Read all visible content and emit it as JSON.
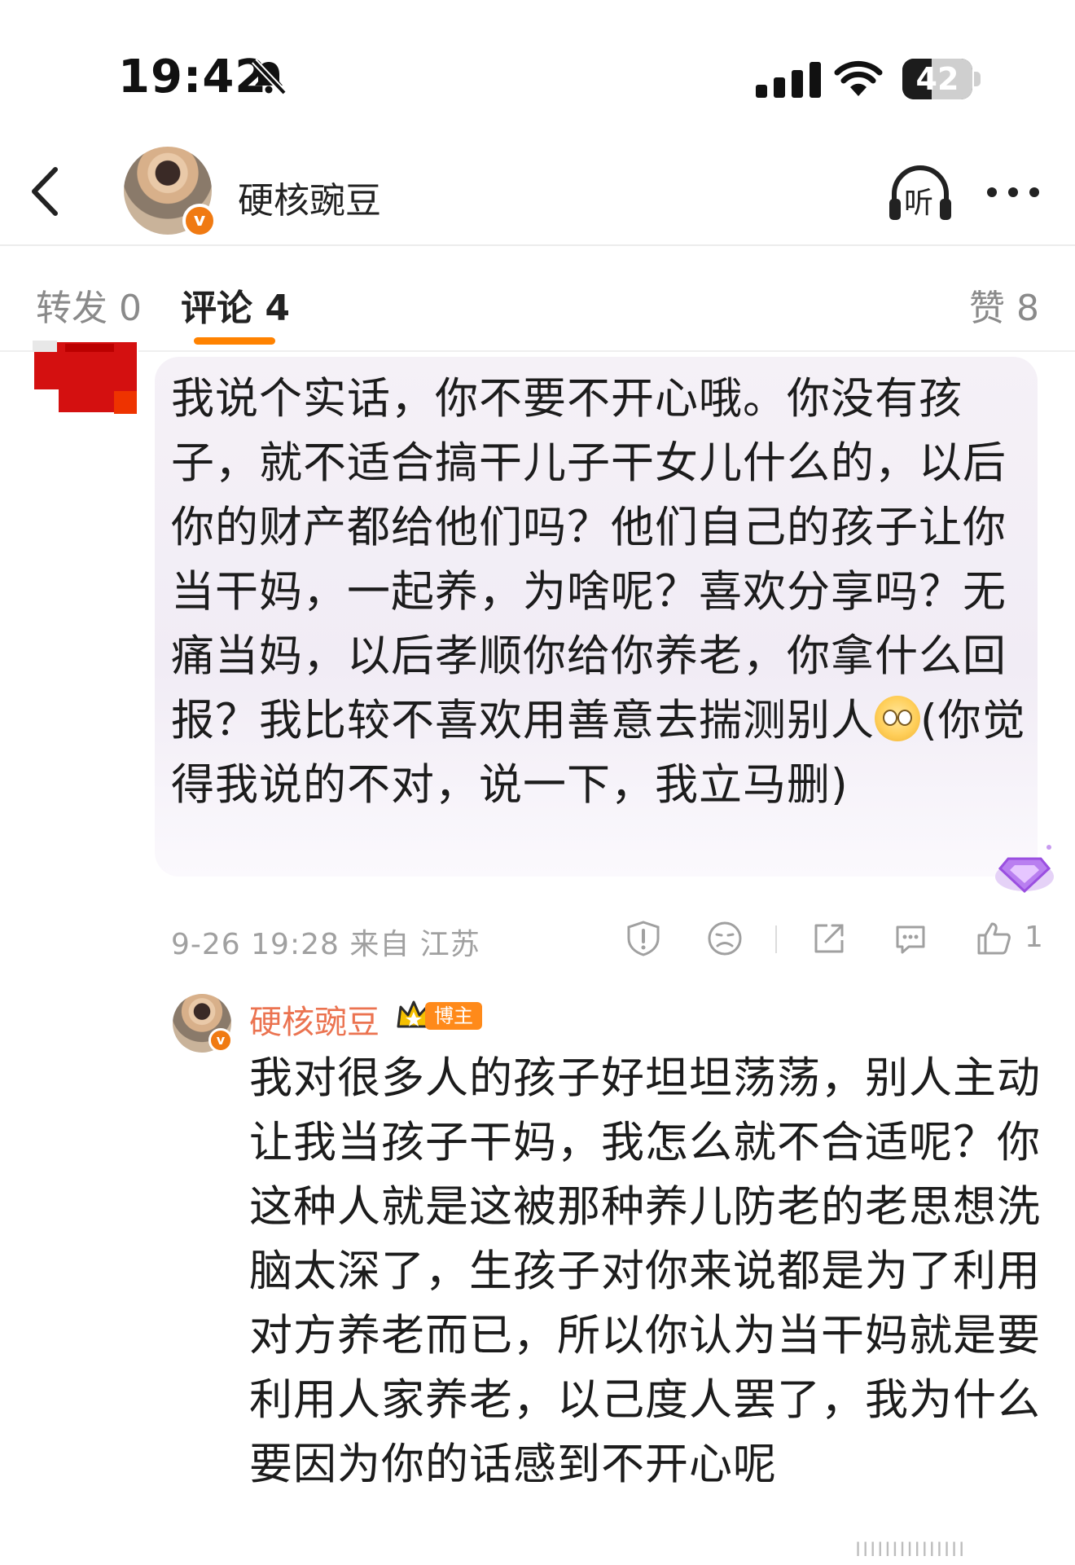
{
  "status_bar": {
    "time": "19:42",
    "battery": "42",
    "battery_level": 0.42
  },
  "header": {
    "username": "硬核豌豆",
    "verified_badge": "v",
    "listen_label": "听"
  },
  "tabs": [
    {
      "label": "转发 0",
      "active": false
    },
    {
      "label": "评论 4",
      "active": true
    },
    {
      "label": "赞 8",
      "active": false
    }
  ],
  "comment": {
    "text": "我说个实话，你不要不开心哦。你没有孩子，就不适合搞干儿子干女儿什么的，以后你的财产都给他们吗？他们自己的孩子让你当干妈，一起养，为啥呢？喜欢分享吗？无痛当妈，以后孝顺你给你养老，你拿什么回报？我比较不喜欢用善意去揣测别人",
    "text_after_emoji": "(你觉得我说的不对，说一下，我立马删)",
    "emoji": "eye-roll-emoji",
    "meta": "9-26 19:28 来自 江苏",
    "like_count": "1"
  },
  "reply": {
    "username": "硬核豌豆",
    "badge_label": "博主",
    "text": "我对很多人的孩子好坦坦荡荡，别人主动让我当孩子干妈，我怎么就不合适呢？你这种人就是这被那种养儿防老的老思想洗脑太深了，生孩子对你来说都是为了利用对方养老而已，所以你认为当干妈就是要利用人家养老，以己度人罢了，我为什么要因为你的话感到不开心呢"
  },
  "watermark": "IIIIIIIIIIIIIII",
  "colors": {
    "accent": "#ff8200",
    "username": "#eb7350",
    "meta": "#a0a0a0"
  }
}
